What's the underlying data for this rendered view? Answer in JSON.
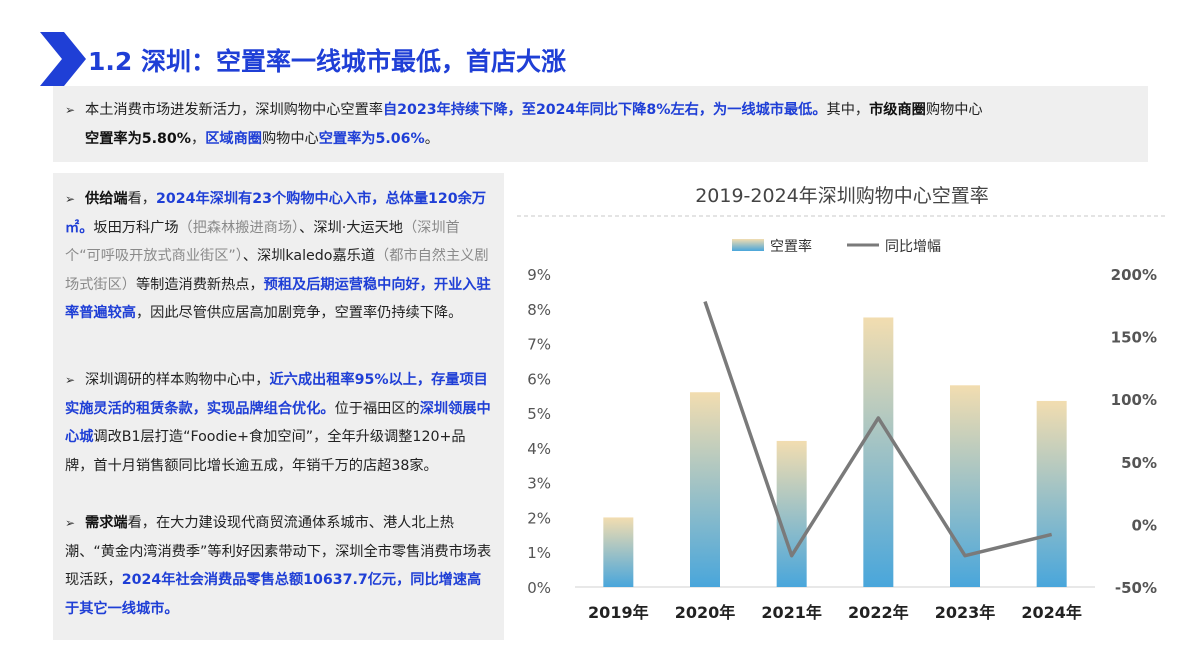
{
  "header": {
    "title": "1.2 深圳：空置率一线城市最低，首店大涨"
  },
  "summary": {
    "bullet": "➢",
    "s1": "本土消费市场进发新活力，深圳购物中心空置率",
    "s2": "自2023年持续下降，至2024年同比下降8%左右，为一线城市最低。",
    "s3": "其中，",
    "s4": "市级商圈",
    "s5": "购物中心",
    "s6": "空置率为5.80%",
    "s7": "，",
    "s8": "区域商圈",
    "s9": "购物中心",
    "s10": "空置率为5.06%",
    "s11": "。"
  },
  "left": {
    "p1": {
      "bullet": "➢",
      "a": "供给端",
      "b": "看，",
      "c": "2024年深圳有23个购物中心入市，总体量120余万㎡。",
      "d": "坂田万科广场",
      "e": "（把森林搬进商场）",
      "f": "、深圳·大运天地",
      "g": "（深圳首个“可呼吸开放式商业街区”）",
      "h": "、深圳kaledo嘉乐道",
      "i": "（都市自然主义剧场式街区）",
      "j": "等制造消费新热点，",
      "k": "预租及后期运营稳中向好，开业入驻率普遍较高",
      "l": "，因此尽管供应居高加剧竞争，空置率仍持续下降。"
    },
    "p2": {
      "bullet": "➢",
      "a": "深圳调研的样本购物中心中，",
      "b": "近六成出租率95%以上，存量项目实施灵活的租赁条款，实现品牌组合优化。",
      "c": "位于福田区的",
      "d": "深圳领展中心城",
      "e": "调改B1层打造“Foodie+食加空间”，全年升级调整120+品牌，首十月销售额同比增长逾五成，年销千万的店超38家。"
    },
    "p3": {
      "bullet": "➢",
      "a": "需求端",
      "b": "看，在大力建设现代商贸流通体系城市、港人北上热潮、“黄金内湾消费季”等利好因素带动下，深圳全市零售消费市场表现活跃，",
      "c": "2024年社会消费品零售总额10637.7亿元，同比增速高于其它一线城市。"
    }
  },
  "chart_data": {
    "type": "bar",
    "title": "2019-2024年深圳购物中心空置率",
    "categories": [
      "2019年",
      "2020年",
      "2021年",
      "2022年",
      "2023年",
      "2024年"
    ],
    "series": [
      {
        "name": "空置率",
        "type": "bar",
        "axis": "left",
        "values": [
          2.0,
          5.6,
          4.2,
          7.75,
          5.8,
          5.35
        ]
      },
      {
        "name": "同比增幅",
        "type": "line",
        "axis": "right",
        "values": [
          null,
          178,
          -25,
          85,
          -25,
          -8
        ]
      }
    ],
    "y_left": {
      "ticks": [
        "0%",
        "1%",
        "2%",
        "3%",
        "4%",
        "5%",
        "6%",
        "7%",
        "8%",
        "9%"
      ],
      "min": 0,
      "max": 9
    },
    "y_right": {
      "ticks": [
        "-50%",
        "0%",
        "50%",
        "100%",
        "150%",
        "200%"
      ],
      "min": -50,
      "max": 200
    },
    "legend_position": "top",
    "colors": {
      "bar_top": "#f2ddb0",
      "bar_bottom": "#49a6db",
      "line": "#7a7a7a"
    }
  }
}
